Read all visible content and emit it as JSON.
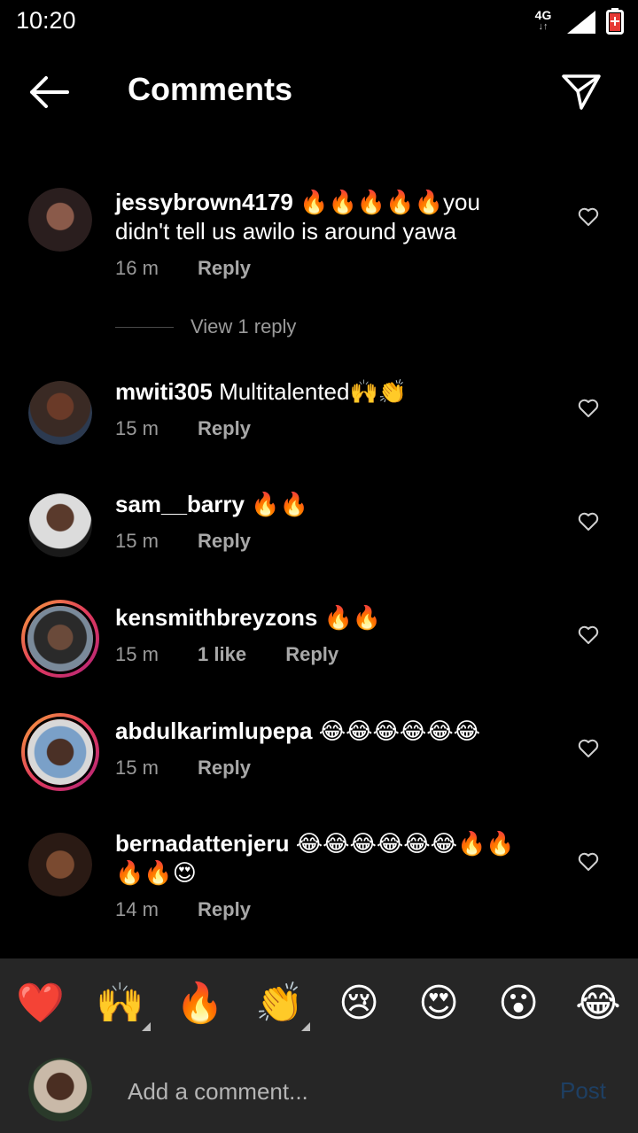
{
  "status_bar": {
    "time": "10:20",
    "network": "4G"
  },
  "header": {
    "title": "Comments"
  },
  "comments": [
    {
      "username": "jessybrown4179",
      "text": "🔥🔥🔥🔥🔥you didn't tell us awilo is around yawa",
      "time": "16 m",
      "likes": "",
      "reply_label": "Reply",
      "view_replies": "View 1 reply",
      "avatar_color": "#5a3a3a"
    },
    {
      "username": "mwiti305",
      "text": "Multitalented🙌👏",
      "time": "15 m",
      "likes": "",
      "reply_label": "Reply",
      "avatar_color": "#6b4a3a"
    },
    {
      "username": "sam__barry",
      "text": "🔥🔥",
      "time": "15 m",
      "likes": "",
      "reply_label": "Reply",
      "avatar_color": "#3e3e44"
    },
    {
      "username": "kensmithbreyzons",
      "text": "🔥🔥",
      "time": "15 m",
      "likes": "1 like",
      "reply_label": "Reply",
      "avatar_color": "#4a5a6a"
    },
    {
      "username": "abdulkarimlupepa",
      "text": "😂😂😂😂😂😂",
      "time": "15 m",
      "likes": "",
      "reply_label": "Reply",
      "avatar_color": "#7a8aa0"
    },
    {
      "username": "bernadattenjeru",
      "text": "😂😂😂😂😂😂🔥🔥🔥🔥😍",
      "time": "14 m",
      "likes": "",
      "reply_label": "Reply",
      "avatar_color": "#5a3c2c"
    }
  ],
  "quick_reactions": [
    "❤️",
    "🙌",
    "🔥",
    "👏",
    "😢",
    "😍",
    "😮",
    "😂"
  ],
  "composer": {
    "placeholder": "Add a comment...",
    "post_label": "Post"
  },
  "colors": {
    "background": "#000000",
    "panel": "#262626",
    "post_disabled": "#1e3f63",
    "muted_text": "#9a9a9a"
  }
}
